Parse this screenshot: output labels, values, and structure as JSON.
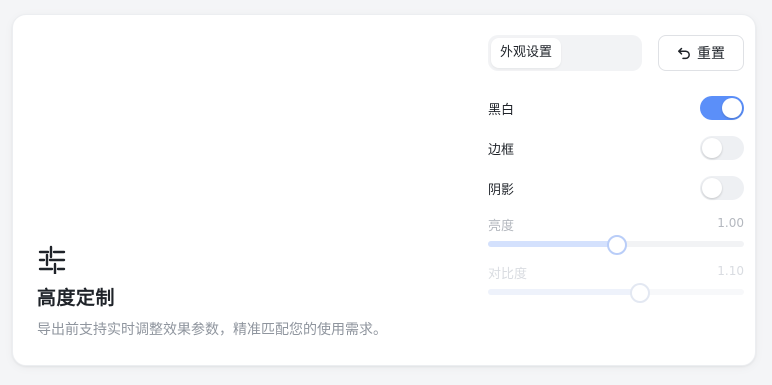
{
  "feature": {
    "icon": "sliders-icon",
    "title": "高度定制",
    "description": "导出前支持实时调整效果参数，精准匹配您的使用需求。"
  },
  "settings": {
    "tab_label": "外观设置",
    "reset_label": "重置",
    "reset_icon": "undo-icon",
    "toggles": [
      {
        "label": "黑白",
        "on": true
      },
      {
        "label": "边框",
        "on": false
      },
      {
        "label": "阴影",
        "on": false
      }
    ],
    "sliders": [
      {
        "label": "亮度",
        "value": "1.00",
        "level": 0.5
      },
      {
        "label": "对比度",
        "value": "1.10",
        "level": 0.59
      }
    ],
    "accent_color": "#5b8ff9"
  }
}
